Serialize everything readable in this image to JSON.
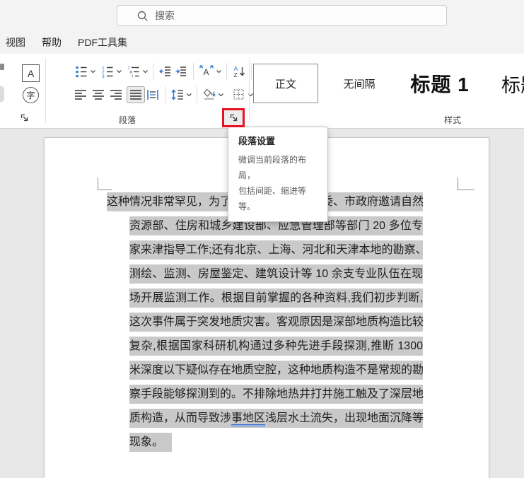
{
  "search": {
    "placeholder": "搜索"
  },
  "menu": {
    "items": [
      {
        "id": "view",
        "label": "视图"
      },
      {
        "id": "help",
        "label": "帮助"
      },
      {
        "id": "pdf-tools",
        "label": "PDF工具集"
      }
    ]
  },
  "ribbon": {
    "font_group": {
      "char_border_label": "A",
      "enclose_char_label": "字"
    },
    "paragraph_group": {
      "label": "段落"
    },
    "styles_group": {
      "label": "样式",
      "styles": [
        {
          "id": "normal",
          "label": "正文",
          "kind": "body",
          "selected": true
        },
        {
          "id": "no-spacing",
          "label": "无间隔",
          "kind": "body",
          "selected": false
        },
        {
          "id": "heading-1",
          "label": "标题 1",
          "kind": "h1",
          "selected": false
        },
        {
          "id": "heading",
          "label": "标题",
          "kind": "h2",
          "selected": false
        }
      ]
    }
  },
  "tooltip": {
    "title": "段落设置",
    "lines": [
      "微调当前段落的布局，",
      "包括间距、缩进等等。"
    ]
  },
  "icons": {
    "search": "magnifier",
    "dialog-launcher": "corner-arrow-southeast",
    "chevron": "⌄",
    "bullets": "blue-squares-list",
    "numbering": "numbered-list-123",
    "multilevel-list": "outline-list-1ai",
    "decrease-indent": "lines-arrow-left",
    "increase-indent": "lines-arrow-right",
    "asian-layout": "A-with-width-arrows",
    "sort": "A-Z-down-arrow",
    "formatting-marks": "return-arrow",
    "align-left": "lines-left",
    "align-center": "lines-center",
    "align-right": "lines-right",
    "justify": "lines-full",
    "distribute": "lines-between-bars",
    "line-spacing": "up-down-arrow-lines",
    "shading": "paint-bucket",
    "borders": "dotted-square-cross"
  },
  "document": {
    "selection_color": "#c9c9c9",
    "lines": [
      "这种情况非常罕见，为了搞清原因，天津市委、市政府邀请自然",
      "资源部、住房和城乡建设部、应急管理部等部门 20 多位专",
      "家来津指导工作;还有北京、上海、河北和天津本地的勘察、",
      "测绘、监测、房屋鉴定、建筑设计等 10 余支专业队伍在现",
      "场开展监测工作。根据目前掌握的各种资料,我们初步判断,",
      "这次事件属于突发地质灾害。客观原因是深部地质构造比较",
      "复杂,根据国家科研机构通过多种先进手段探测,推断 1300",
      "米深度以下疑似存在地质空腔，这种地质构造不是常规的勘",
      "察手段能够探测到的。不排除地热井打井施工触及了深层地",
      {
        "pre": "质构造，从而导致涉",
        "marked": "事地区",
        "post": "浅层水土流失，出现地面沉降等"
      },
      "现象。"
    ]
  }
}
